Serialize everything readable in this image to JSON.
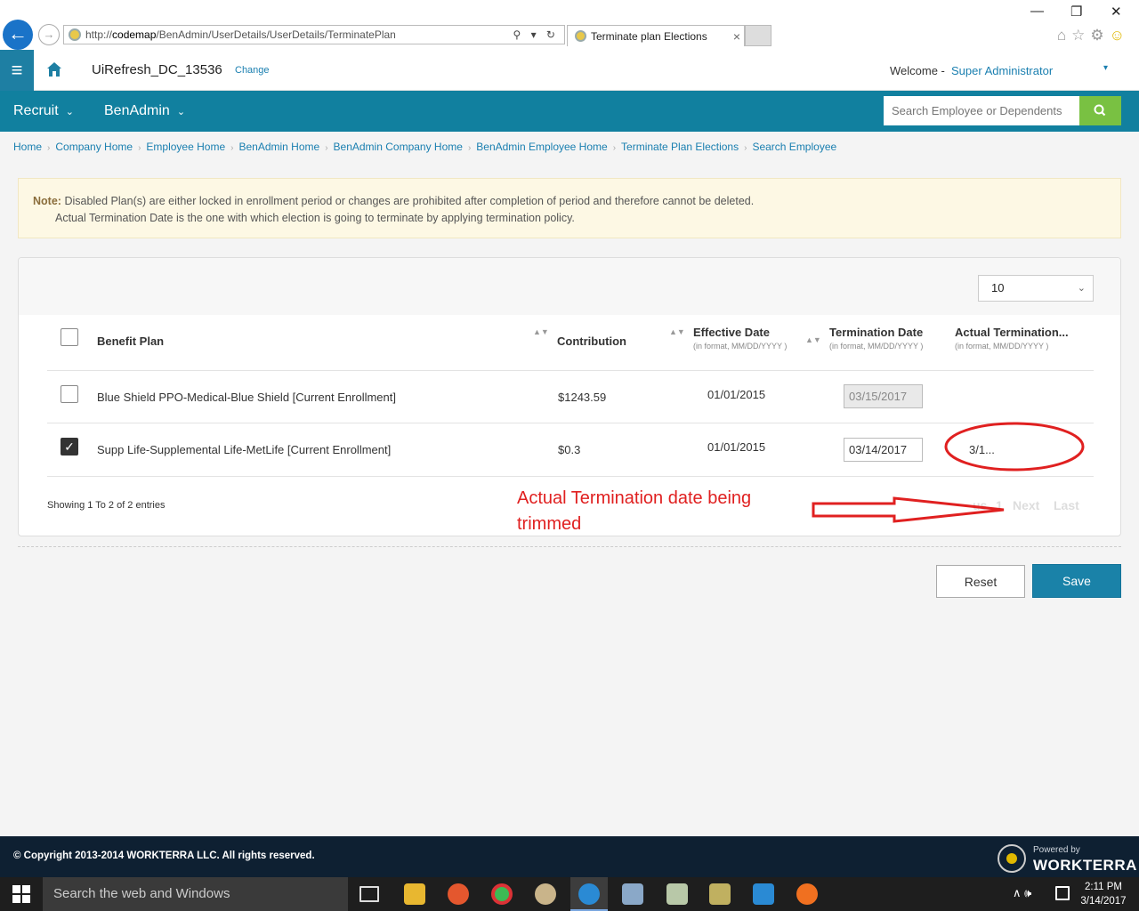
{
  "browser": {
    "url_prefix": "http://",
    "url_host": "codemap",
    "url_path": "/BenAdmin/UserDetails/UserDetails/TerminatePlan",
    "url_tools": "⚲ ▾ ↻",
    "tab_title": "Terminate plan Elections",
    "tab_close": "×",
    "win_min": "—",
    "win_restore": "❐",
    "win_close": "✕",
    "home_glyph": "⌂",
    "star_glyph": "☆",
    "gear_glyph": "⚙",
    "smile_glyph": "☺"
  },
  "header": {
    "menu_glyph": "≡",
    "tenant": "UiRefresh_DC_13536",
    "change_label": "Change",
    "welcome_label": "Welcome -",
    "user_name": "Super Administrator",
    "user_caret": "▾"
  },
  "nav": {
    "items": [
      {
        "label": "Recruit",
        "caret": "⌄"
      },
      {
        "label": "BenAdmin",
        "caret": "⌄"
      }
    ],
    "search_placeholder": "Search Employee or Dependents"
  },
  "breadcrumb": {
    "separator": "›",
    "items": [
      "Home",
      "Company Home",
      "Employee Home",
      "BenAdmin Home",
      "BenAdmin Company Home",
      "BenAdmin Employee Home",
      "Terminate Plan Elections",
      "Search Employee"
    ]
  },
  "note": {
    "label": "Note:",
    "line1": "Disabled Plan(s) are either locked in enrollment period or changes are prohibited after completion of period and therefore cannot be deleted.",
    "line2": "Actual Termination Date is the one with which election is going to terminate by applying termination policy."
  },
  "grid": {
    "page_size": "10",
    "page_size_chevron": "⌄",
    "sort_glyph": "▲▼",
    "check_glyph": "✓",
    "columns": {
      "benefit_plan": "Benefit Plan",
      "contribution": "Contribution",
      "effective_date": "Effective Date",
      "termination_date": "Termination Date",
      "actual_termination": "Actual Termination...",
      "date_format": "(in format, MM/DD/YYYY )"
    },
    "rows": [
      {
        "checked": false,
        "plan": "Blue Shield PPO-Medical-Blue Shield [Current Enrollment]",
        "contribution": "$1243.59",
        "effective": "01/01/2015",
        "termination": "03/15/2017",
        "termination_disabled": true,
        "actual": ""
      },
      {
        "checked": true,
        "plan": "Supp Life-Supplemental Life-MetLife [Current Enrollment]",
        "contribution": "$0.3",
        "effective": "01/01/2015",
        "termination": "03/14/2017",
        "termination_disabled": false,
        "actual": "3/1..."
      }
    ],
    "showing": "Showing 1 To 2 of 2 entries",
    "pager": {
      "previous_fragment": "us",
      "page": "1",
      "next": "Next",
      "last": "Last"
    }
  },
  "actions": {
    "reset": "Reset",
    "save": "Save"
  },
  "annotation": {
    "line1": "Actual Termination date being",
    "line2": "trimmed",
    "color": "#e02020"
  },
  "footer": {
    "copyright": "© Copyright 2013-2014 WORKTERRA LLC. All rights reserved.",
    "powered_by": "Powered by",
    "brand": "WORKTERRA"
  },
  "taskbar": {
    "search_placeholder": "Search the web and Windows",
    "tray_glyphs": "∧  🕪",
    "time": "2:11 PM",
    "date": "3/14/2017"
  },
  "colors": {
    "brand_teal": "#11809f",
    "accent_green": "#79c142",
    "link_blue": "#1a7fb0",
    "footer_navy": "#0e2032"
  }
}
